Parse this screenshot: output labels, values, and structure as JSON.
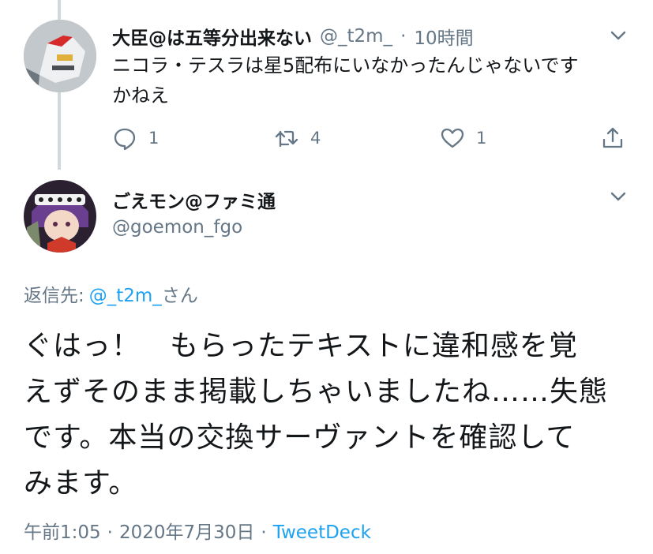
{
  "colors": {
    "link": "#1da1f2",
    "muted": "#657786",
    "text": "#14171a",
    "thread_line": "#cfd9de"
  },
  "reply_tweet": {
    "display_name": "大臣@は五等分出来ない",
    "handle": "@_t2m_",
    "separator": "·",
    "time": "10時間",
    "text": "ニコラ・テスラは星5配布にいなかったんじゃないです\nかねえ",
    "avatar_icon": "robot-avatar",
    "more_icon": "chevron-down-icon",
    "actions": {
      "reply_icon": "reply-icon",
      "reply_count": "1",
      "retweet_icon": "retweet-icon",
      "retweet_count": "4",
      "like_icon": "heart-icon",
      "like_count": "1",
      "share_icon": "share-icon"
    }
  },
  "main_tweet": {
    "display_name": "ごえモン@ファミ通",
    "handle": "@goemon_fgo",
    "avatar_icon": "character-avatar",
    "more_icon": "chevron-down-icon",
    "replying_to_label": "返信先:",
    "replying_to_mention": "@_t2m_",
    "replying_to_suffix": "さん",
    "text_lines": [
      "ぐはっ！　もらったテキストに違和感を覚",
      "えずそのまま掲載しちゃいましたね……失態",
      "です。本当の交換サーヴァントを確認して",
      "みます。"
    ],
    "time": "午前1:05",
    "date": "2020年7月30日",
    "separator": "·",
    "source": "TweetDeck"
  }
}
